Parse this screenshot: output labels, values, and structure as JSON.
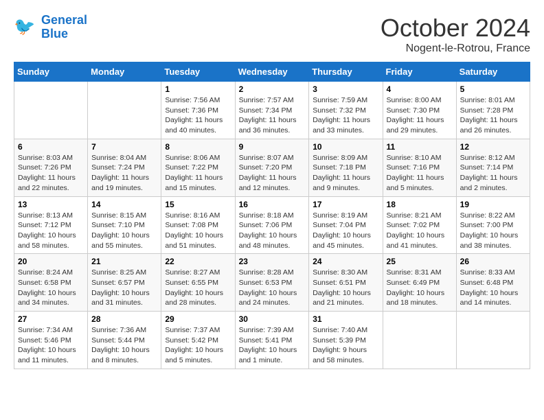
{
  "header": {
    "logo_line1": "General",
    "logo_line2": "Blue",
    "month": "October 2024",
    "location": "Nogent-le-Rotrou, France"
  },
  "weekdays": [
    "Sunday",
    "Monday",
    "Tuesday",
    "Wednesday",
    "Thursday",
    "Friday",
    "Saturday"
  ],
  "weeks": [
    [
      {
        "day": "",
        "sunrise": "",
        "sunset": "",
        "daylight": ""
      },
      {
        "day": "",
        "sunrise": "",
        "sunset": "",
        "daylight": ""
      },
      {
        "day": "1",
        "sunrise": "Sunrise: 7:56 AM",
        "sunset": "Sunset: 7:36 PM",
        "daylight": "Daylight: 11 hours and 40 minutes."
      },
      {
        "day": "2",
        "sunrise": "Sunrise: 7:57 AM",
        "sunset": "Sunset: 7:34 PM",
        "daylight": "Daylight: 11 hours and 36 minutes."
      },
      {
        "day": "3",
        "sunrise": "Sunrise: 7:59 AM",
        "sunset": "Sunset: 7:32 PM",
        "daylight": "Daylight: 11 hours and 33 minutes."
      },
      {
        "day": "4",
        "sunrise": "Sunrise: 8:00 AM",
        "sunset": "Sunset: 7:30 PM",
        "daylight": "Daylight: 11 hours and 29 minutes."
      },
      {
        "day": "5",
        "sunrise": "Sunrise: 8:01 AM",
        "sunset": "Sunset: 7:28 PM",
        "daylight": "Daylight: 11 hours and 26 minutes."
      }
    ],
    [
      {
        "day": "6",
        "sunrise": "Sunrise: 8:03 AM",
        "sunset": "Sunset: 7:26 PM",
        "daylight": "Daylight: 11 hours and 22 minutes."
      },
      {
        "day": "7",
        "sunrise": "Sunrise: 8:04 AM",
        "sunset": "Sunset: 7:24 PM",
        "daylight": "Daylight: 11 hours and 19 minutes."
      },
      {
        "day": "8",
        "sunrise": "Sunrise: 8:06 AM",
        "sunset": "Sunset: 7:22 PM",
        "daylight": "Daylight: 11 hours and 15 minutes."
      },
      {
        "day": "9",
        "sunrise": "Sunrise: 8:07 AM",
        "sunset": "Sunset: 7:20 PM",
        "daylight": "Daylight: 11 hours and 12 minutes."
      },
      {
        "day": "10",
        "sunrise": "Sunrise: 8:09 AM",
        "sunset": "Sunset: 7:18 PM",
        "daylight": "Daylight: 11 hours and 9 minutes."
      },
      {
        "day": "11",
        "sunrise": "Sunrise: 8:10 AM",
        "sunset": "Sunset: 7:16 PM",
        "daylight": "Daylight: 11 hours and 5 minutes."
      },
      {
        "day": "12",
        "sunrise": "Sunrise: 8:12 AM",
        "sunset": "Sunset: 7:14 PM",
        "daylight": "Daylight: 11 hours and 2 minutes."
      }
    ],
    [
      {
        "day": "13",
        "sunrise": "Sunrise: 8:13 AM",
        "sunset": "Sunset: 7:12 PM",
        "daylight": "Daylight: 10 hours and 58 minutes."
      },
      {
        "day": "14",
        "sunrise": "Sunrise: 8:15 AM",
        "sunset": "Sunset: 7:10 PM",
        "daylight": "Daylight: 10 hours and 55 minutes."
      },
      {
        "day": "15",
        "sunrise": "Sunrise: 8:16 AM",
        "sunset": "Sunset: 7:08 PM",
        "daylight": "Daylight: 10 hours and 51 minutes."
      },
      {
        "day": "16",
        "sunrise": "Sunrise: 8:18 AM",
        "sunset": "Sunset: 7:06 PM",
        "daylight": "Daylight: 10 hours and 48 minutes."
      },
      {
        "day": "17",
        "sunrise": "Sunrise: 8:19 AM",
        "sunset": "Sunset: 7:04 PM",
        "daylight": "Daylight: 10 hours and 45 minutes."
      },
      {
        "day": "18",
        "sunrise": "Sunrise: 8:21 AM",
        "sunset": "Sunset: 7:02 PM",
        "daylight": "Daylight: 10 hours and 41 minutes."
      },
      {
        "day": "19",
        "sunrise": "Sunrise: 8:22 AM",
        "sunset": "Sunset: 7:00 PM",
        "daylight": "Daylight: 10 hours and 38 minutes."
      }
    ],
    [
      {
        "day": "20",
        "sunrise": "Sunrise: 8:24 AM",
        "sunset": "Sunset: 6:58 PM",
        "daylight": "Daylight: 10 hours and 34 minutes."
      },
      {
        "day": "21",
        "sunrise": "Sunrise: 8:25 AM",
        "sunset": "Sunset: 6:57 PM",
        "daylight": "Daylight: 10 hours and 31 minutes."
      },
      {
        "day": "22",
        "sunrise": "Sunrise: 8:27 AM",
        "sunset": "Sunset: 6:55 PM",
        "daylight": "Daylight: 10 hours and 28 minutes."
      },
      {
        "day": "23",
        "sunrise": "Sunrise: 8:28 AM",
        "sunset": "Sunset: 6:53 PM",
        "daylight": "Daylight: 10 hours and 24 minutes."
      },
      {
        "day": "24",
        "sunrise": "Sunrise: 8:30 AM",
        "sunset": "Sunset: 6:51 PM",
        "daylight": "Daylight: 10 hours and 21 minutes."
      },
      {
        "day": "25",
        "sunrise": "Sunrise: 8:31 AM",
        "sunset": "Sunset: 6:49 PM",
        "daylight": "Daylight: 10 hours and 18 minutes."
      },
      {
        "day": "26",
        "sunrise": "Sunrise: 8:33 AM",
        "sunset": "Sunset: 6:48 PM",
        "daylight": "Daylight: 10 hours and 14 minutes."
      }
    ],
    [
      {
        "day": "27",
        "sunrise": "Sunrise: 7:34 AM",
        "sunset": "Sunset: 5:46 PM",
        "daylight": "Daylight: 10 hours and 11 minutes."
      },
      {
        "day": "28",
        "sunrise": "Sunrise: 7:36 AM",
        "sunset": "Sunset: 5:44 PM",
        "daylight": "Daylight: 10 hours and 8 minutes."
      },
      {
        "day": "29",
        "sunrise": "Sunrise: 7:37 AM",
        "sunset": "Sunset: 5:42 PM",
        "daylight": "Daylight: 10 hours and 5 minutes."
      },
      {
        "day": "30",
        "sunrise": "Sunrise: 7:39 AM",
        "sunset": "Sunset: 5:41 PM",
        "daylight": "Daylight: 10 hours and 1 minute."
      },
      {
        "day": "31",
        "sunrise": "Sunrise: 7:40 AM",
        "sunset": "Sunset: 5:39 PM",
        "daylight": "Daylight: 9 hours and 58 minutes."
      },
      {
        "day": "",
        "sunrise": "",
        "sunset": "",
        "daylight": ""
      },
      {
        "day": "",
        "sunrise": "",
        "sunset": "",
        "daylight": ""
      }
    ]
  ]
}
